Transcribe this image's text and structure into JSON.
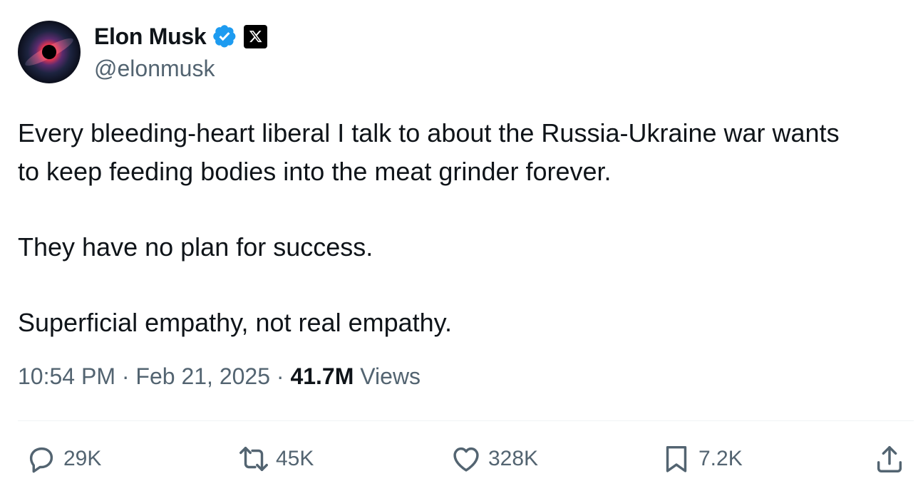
{
  "author": {
    "display_name": "Elon Musk",
    "handle": "@elonmusk",
    "verified": true,
    "affiliation_badge": "x-logo-icon"
  },
  "tweet": {
    "paragraphs": [
      "Every bleeding-heart liberal I talk to about the Russia-Ukraine war wants",
      "to keep feeding bodies into the meat grinder forever.",
      "They have no plan for success.",
      "Superficial empathy, not real empathy."
    ]
  },
  "meta": {
    "time": "10:54 PM",
    "separator": "·",
    "date": "Feb 21, 2025",
    "views_count": "41.7M",
    "views_label": "Views"
  },
  "actions": {
    "reply": {
      "icon": "reply-icon",
      "count": "29K"
    },
    "repost": {
      "icon": "repost-icon",
      "count": "45K"
    },
    "like": {
      "icon": "heart-icon",
      "count": "328K"
    },
    "bookmark": {
      "icon": "bookmark-icon",
      "count": "7.2K"
    },
    "share": {
      "icon": "share-icon"
    }
  },
  "colors": {
    "text": "#0f1419",
    "secondary_text": "#536471",
    "verified_blue": "#1d9bf0",
    "divider": "#eff3f4"
  }
}
